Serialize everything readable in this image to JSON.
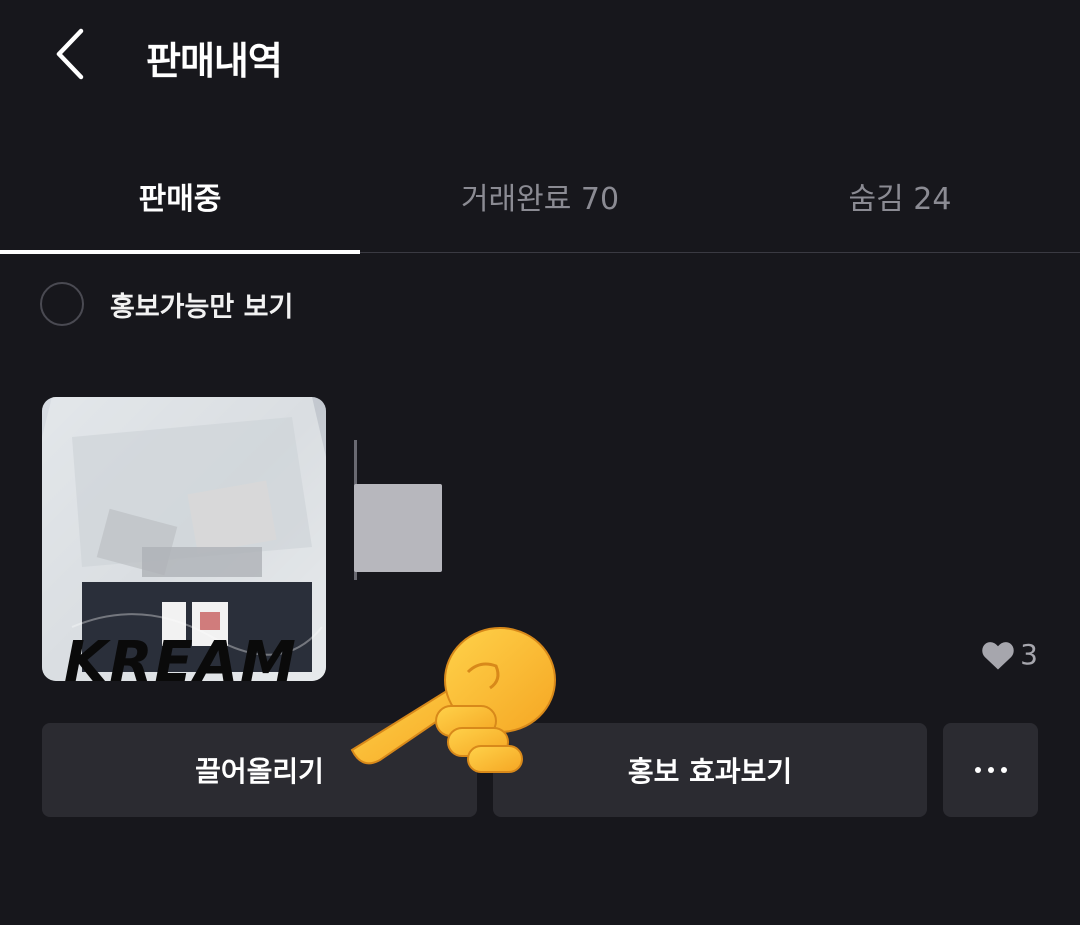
{
  "header": {
    "title": "판매내역",
    "back_icon": "chevron-left-icon"
  },
  "tabs": [
    {
      "label": "판매중",
      "active": true
    },
    {
      "label": "거래완료 70",
      "active": false
    },
    {
      "label": "숨김 24",
      "active": false
    }
  ],
  "filter": {
    "label": "홍보가능만 보기",
    "checked": false
  },
  "listing": {
    "thumbnail_text": "KREAM",
    "likes": "3",
    "like_icon": "heart-icon"
  },
  "actions": {
    "bump_label": "끌어올리기",
    "promo_label": "홍보 효과보기",
    "more_icon": "more-horizontal-icon"
  },
  "colors": {
    "background": "#17171c",
    "button": "#2b2b31",
    "muted_text": "#8b8b93"
  }
}
